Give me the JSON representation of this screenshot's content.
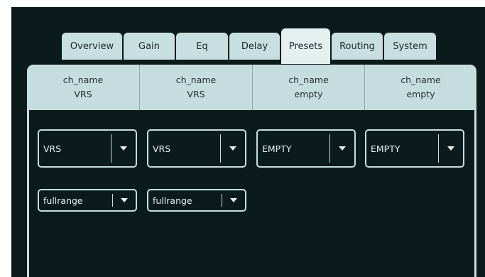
{
  "tabs": [
    {
      "label": "Overview",
      "active": false
    },
    {
      "label": "Gain",
      "active": false
    },
    {
      "label": "Eq",
      "active": false
    },
    {
      "label": "Delay",
      "active": false
    },
    {
      "label": "Presets",
      "active": true
    },
    {
      "label": "Routing",
      "active": false
    },
    {
      "label": "System",
      "active": false
    }
  ],
  "channels": [
    {
      "name": "ch_name",
      "preset": "VRS"
    },
    {
      "name": "ch_name",
      "preset": "VRS"
    },
    {
      "name": "ch_name",
      "preset": "empty"
    },
    {
      "name": "ch_name",
      "preset": "empty"
    }
  ],
  "preset_selects": [
    "VRS",
    "VRS",
    "EMPTY",
    "EMPTY"
  ],
  "range_selects": [
    "fullrange",
    "fullrange"
  ],
  "colors": {
    "background": "#0b1a1b",
    "tab": "#c7dfe0",
    "tab_active": "#e4f0f0",
    "header": "#c6dddf",
    "control_border": "#c9dede",
    "text_light": "#e8f2f2"
  },
  "icons": {
    "dropdown": "chevron-down-icon"
  }
}
